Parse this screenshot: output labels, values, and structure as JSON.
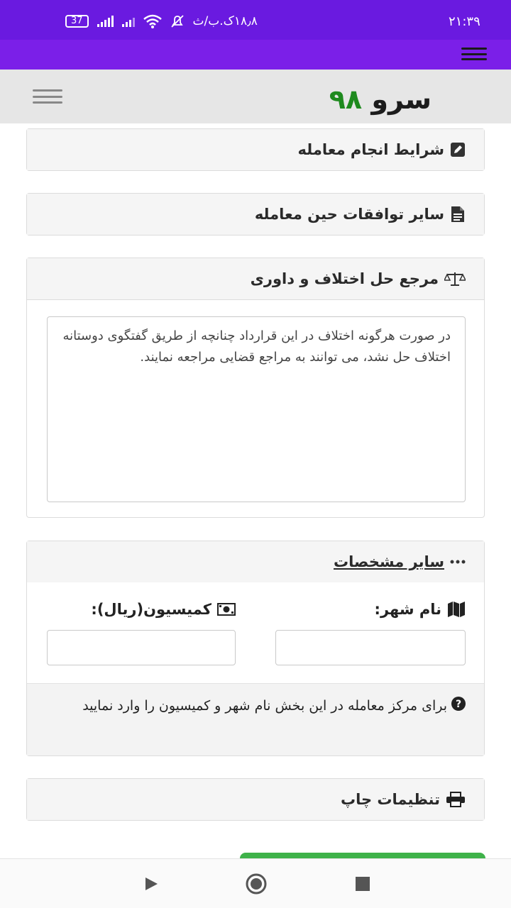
{
  "status_bar": {
    "time": "۲۱:۳۹",
    "network_speed": "۱۸٫۸ک.ب/ث",
    "battery": "37"
  },
  "app_bar": {
    "logo_word": "سرو",
    "logo_number": "۹۸"
  },
  "sections": {
    "trade_conditions": {
      "title": "شرایط انجام معامله"
    },
    "other_agreements": {
      "title": "سایر توافقات حین معامله"
    },
    "dispute": {
      "title": "مرجع حل اختلاف و داوری",
      "text": "در صورت هرگونه اختلاف در این قرارداد چنانچه از طریق گفتگوی دوستانه اختلاف حل نشد،  می توانند به مراجع قضایی مراجعه نمایند."
    },
    "other_specs": {
      "title": "سایر مشخصات",
      "city_label": "نام شهر:",
      "city_value": "",
      "commission_label": "کمیسیون(ریال):",
      "commission_value": "",
      "help_text": "برای مرکز معامله در این بخش نام شهر و کمیسیون را وارد نمایید"
    },
    "print_settings": {
      "title": "تنظیمات چاپ"
    }
  },
  "icons": {
    "edit": "pencil-square-icon",
    "document": "file-text-icon",
    "scales": "balance-scale-icon",
    "dots": "ellipsis-icon",
    "map": "map-icon",
    "money": "money-bill-icon",
    "question": "question-circle-icon",
    "print": "print-icon"
  },
  "colors": {
    "status_bar": "#6a1ae0",
    "purple_bar": "#7b1fe8",
    "logo_green": "#1e8a1e",
    "action_green": "#3fb24a"
  }
}
